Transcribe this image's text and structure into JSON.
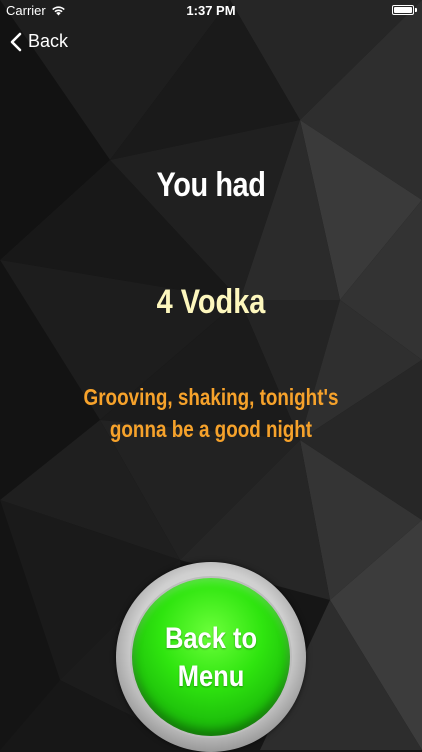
{
  "status_bar": {
    "carrier": "Carrier",
    "time": "1:37 PM",
    "battery_level": 1.0
  },
  "nav": {
    "back_label": "Back"
  },
  "result": {
    "intro": "You had",
    "drink_count": "4 Vodka",
    "message_line1": "Grooving, shaking, tonight's",
    "message_line2": "gonna be a good night"
  },
  "menu_button": {
    "line1": "Back to",
    "line2": "Menu"
  },
  "colors": {
    "background": "#151515",
    "drink_text": "#fdf7bd",
    "message_text": "#f6a22b",
    "button_green": "#2fe50f"
  }
}
